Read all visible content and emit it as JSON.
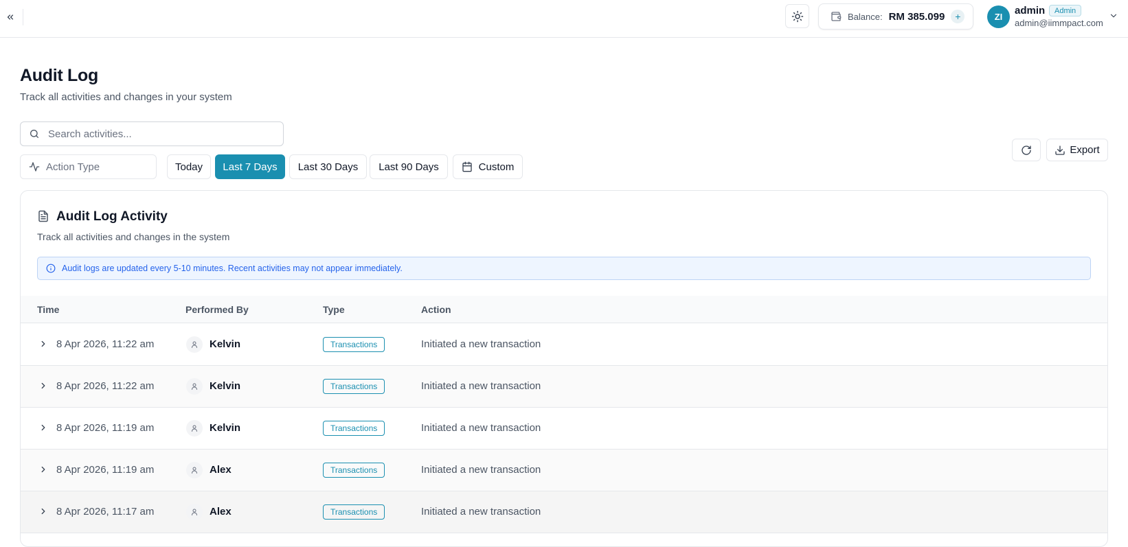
{
  "topbar": {
    "balance_label": "Balance:",
    "balance_value": "RM 385.099",
    "balance_add": "+",
    "user_initials": "ZI",
    "user_name": "admin",
    "user_role": "Admin",
    "user_email": "admin@iimmpact.com"
  },
  "header": {
    "title": "Audit Log",
    "subtitle": "Track all activities and changes in your system"
  },
  "search": {
    "placeholder": "Search activities..."
  },
  "filters": {
    "action_type_placeholder": "Action Type",
    "ranges": [
      {
        "label": "Today",
        "active": false
      },
      {
        "label": "Last 7 Days",
        "active": true
      },
      {
        "label": "Last 30 Days",
        "active": false
      },
      {
        "label": "Last 90 Days",
        "active": false
      }
    ],
    "custom_label": "Custom"
  },
  "toolbar": {
    "export_label": "Export"
  },
  "card": {
    "title": "Audit Log Activity",
    "subtitle": "Track all activities and changes in the system",
    "notice": "Audit logs are updated every 5-10 minutes. Recent activities may not appear immediately."
  },
  "table": {
    "columns": [
      "Time",
      "Performed By",
      "Type",
      "Action"
    ],
    "rows": [
      {
        "time": "8 Apr 2026, 11:22 am",
        "user": "Kelvin",
        "type": "Transactions",
        "action": "Initiated a new transaction"
      },
      {
        "time": "8 Apr 2026, 11:22 am",
        "user": "Kelvin",
        "type": "Transactions",
        "action": "Initiated a new transaction"
      },
      {
        "time": "8 Apr 2026, 11:19 am",
        "user": "Kelvin",
        "type": "Transactions",
        "action": "Initiated a new transaction"
      },
      {
        "time": "8 Apr 2026, 11:19 am",
        "user": "Alex",
        "type": "Transactions",
        "action": "Initiated a new transaction"
      },
      {
        "time": "8 Apr 2026, 11:17 am",
        "user": "Alex",
        "type": "Transactions",
        "action": "Initiated a new transaction"
      }
    ]
  },
  "colors": {
    "accent": "#1a8fb0",
    "notice_text": "#2563eb",
    "notice_bg": "#eef5ff"
  },
  "icons": [
    "collapse-sidebar-icon",
    "sun-icon",
    "wallet-icon",
    "chevron-down-icon",
    "search-icon",
    "activity-icon",
    "calendar-icon",
    "refresh-icon",
    "download-icon",
    "document-icon",
    "info-icon",
    "chevron-right-icon",
    "user-icon"
  ]
}
